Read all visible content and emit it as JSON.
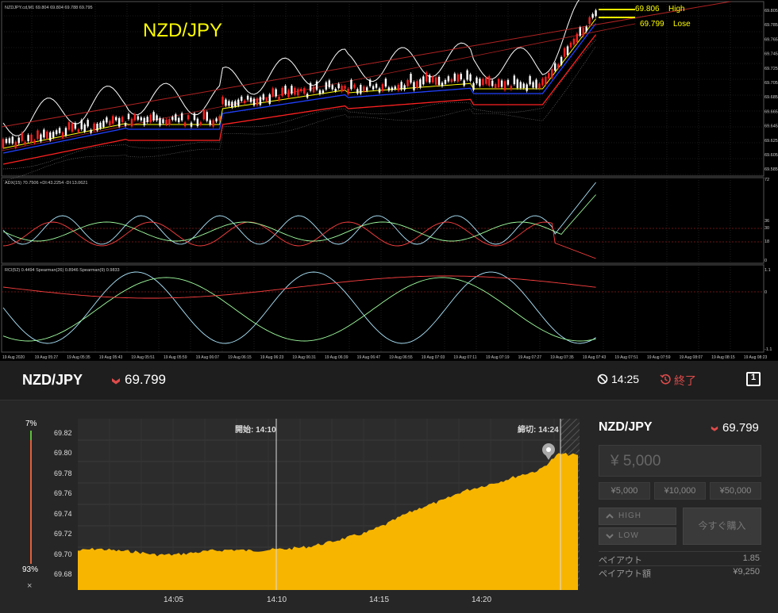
{
  "mt4": {
    "symbol_title": "NZD/JPY",
    "info_line": "NZDJPY.cd,M1  69.804 69.804 69.788 69.795",
    "high_price": "69.806",
    "high_label": "High",
    "lose_price": "69.799",
    "lose_label": "Lose",
    "price_scale": [
      "69.805",
      "69.785",
      "69.765",
      "69.745",
      "69.725",
      "69.705",
      "69.685",
      "69.665",
      "69.645",
      "69.625",
      "69.605",
      "69.585"
    ],
    "adx_label": "ADX(15) 70.7506 +DI:43.2254 -DI:13.0621",
    "adx_scale": [
      "72",
      "36",
      "30",
      "18",
      "0"
    ],
    "rci_label": "RCI(52) 0.4494  Spearman(26) 0.8946  Spearman(9) 0.9833",
    "rci_scale": [
      "1.1",
      "0",
      "-1.1"
    ],
    "time_axis": [
      "19 Aug 2020",
      "19 Aug 05:27",
      "19 Aug 05:35",
      "19 Aug 05:43",
      "19 Aug 05:51",
      "19 Aug 05:59",
      "19 Aug 06:07",
      "19 Aug 06:15",
      "19 Aug 06:23",
      "19 Aug 06:31",
      "19 Aug 06:39",
      "19 Aug 06:47",
      "19 Aug 06:55",
      "19 Aug 07:03",
      "19 Aug 07:11",
      "19 Aug 07:19",
      "19 Aug 07:27",
      "19 Aug 07:35",
      "19 Aug 07:43",
      "19 Aug 07:51",
      "19 Aug 07:59",
      "19 Aug 08:07",
      "19 Aug 08:15",
      "19 Aug 08:23"
    ]
  },
  "header": {
    "pair": "NZD/JPY",
    "rate": "69.799",
    "remaining_time": "14:25",
    "end_label": "終了",
    "expand_icon": "1",
    "colors": {
      "down": "#e04b4b",
      "accent": "#f7b500"
    }
  },
  "gauge": {
    "high_pct": "7%",
    "low_pct": "93%",
    "close": "×",
    "high_fraction": 0.07
  },
  "chart_data": {
    "type": "area",
    "title": "",
    "start_label": "開始: 14:10",
    "deadline_label": "締切: 14:24",
    "y_ticks": [
      "69.82",
      "69.80",
      "69.78",
      "69.76",
      "69.74",
      "69.72",
      "69.70",
      "69.68"
    ],
    "x_ticks": [
      "14:05",
      "14:10",
      "14:15",
      "14:20"
    ],
    "ylim": [
      69.665,
      69.835
    ],
    "x_minutes": [
      0,
      1,
      2,
      3,
      4,
      5,
      6,
      7,
      8,
      9,
      10,
      11,
      12,
      13,
      14,
      15,
      16,
      17,
      18,
      19,
      20,
      21,
      22,
      23,
      24,
      25,
      26
    ],
    "values": [
      69.704,
      69.706,
      69.704,
      69.703,
      69.7,
      69.7,
      69.702,
      69.704,
      69.705,
      69.704,
      69.705,
      69.706,
      69.708,
      69.712,
      69.717,
      69.722,
      69.73,
      69.74,
      69.748,
      69.754,
      69.763,
      69.768,
      69.773,
      69.779,
      69.784,
      69.8,
      69.799
    ],
    "series": [
      {
        "values": [
          69.704,
          69.706,
          69.704,
          69.703,
          69.7,
          69.7,
          69.702,
          69.704,
          69.705,
          69.704,
          69.705,
          69.706,
          69.708,
          69.712,
          69.717,
          69.722,
          69.73,
          69.74,
          69.748,
          69.754,
          69.763,
          69.768,
          69.773,
          69.779,
          69.784,
          69.8,
          69.799
        ]
      }
    ],
    "color": "#f7b500",
    "grid": true
  },
  "panel": {
    "pair": "NZD/JPY",
    "rate": "69.799",
    "amount": "¥ 5,000",
    "chips": [
      "¥5,000",
      "¥10,000",
      "¥50,000"
    ],
    "high_label": "HIGH",
    "low_label": "LOW",
    "buy_now": "今すぐ購入",
    "payout_label": "ペイアウト",
    "payout_value": "1.85",
    "payout_amount_label": "ペイアウト額",
    "payout_amount_value": "¥9,250"
  }
}
